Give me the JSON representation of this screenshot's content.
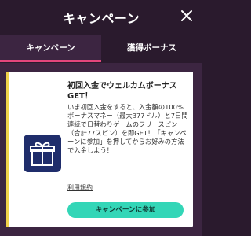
{
  "header": {
    "title": "キャンペーン",
    "close_icon": "close-icon"
  },
  "tabs": [
    {
      "label": "キャンペーン",
      "active": true
    },
    {
      "label": "獲得ボーナス",
      "active": false
    }
  ],
  "promo": {
    "icon": "gift-icon",
    "title": "初回入金でウェルカムボーナスGET！",
    "body": "いま初回入金をすると、入金額の100%ボーナスマネー（最大377ドル）と7日間連続で日替わりゲームのフリースピン（合計77スピン）を即GET！「キャンペーンに参加」を押してからお好みの方法で入金しよう！",
    "terms_link": "利用規約",
    "cta_label": "キャンペーンに参加"
  },
  "colors": {
    "background": "#2a1a2d",
    "tab_active_bg": "#3c2541",
    "tab_underline": "#e2467c",
    "card_accent": "#f0d24a",
    "cta": "#33d6b7",
    "icon_bg": "#1f2d6b"
  }
}
